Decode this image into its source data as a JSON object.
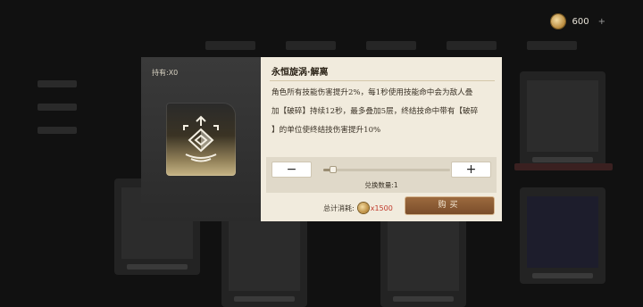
{
  "currency": {
    "amount": "600",
    "icon": "coin-icon",
    "add": "+"
  },
  "modal": {
    "owned": "持有:X0",
    "title": "永恒旋涡·解离",
    "description": "角色所有技能伤害提升2%，每1秒使用技能命中会为敌人叠\n加【破碎】持续12秒，最多叠加5层，终结技命中带有【破碎\n】的单位使终结技伤害提升10%",
    "minus": "−",
    "plus": "+",
    "quantity_label": "兑换数量:1",
    "slider_fraction": 0.08,
    "total_label": "总计消耗:",
    "total_cost": "x1500",
    "buy_label": "购买"
  },
  "colors": {
    "accent": "#8a5a32",
    "cost": "#c0392b",
    "panel": "#f1ebdd"
  }
}
